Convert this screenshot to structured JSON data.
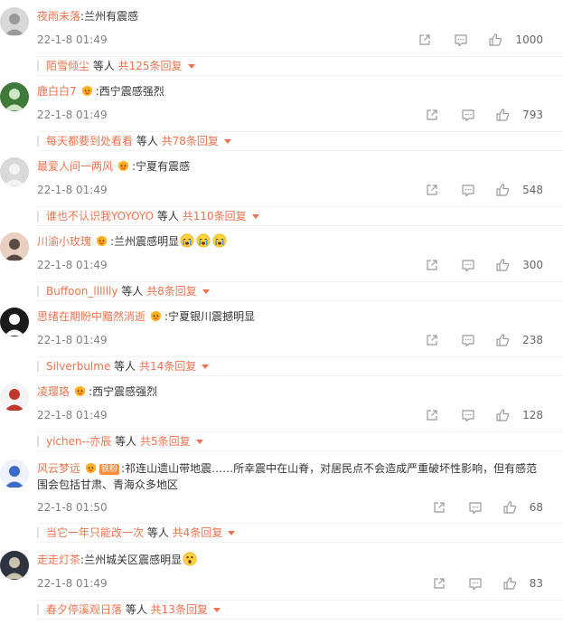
{
  "colors": {
    "accent": "#eb7350",
    "meta": "#808080",
    "text": "#333333"
  },
  "comments": [
    {
      "user": "夜雨未落",
      "badge": false,
      "colon": ":",
      "text": "兰州有震感",
      "emojis": [],
      "time": "22-1-8 01:49",
      "likes": "1000",
      "reply_user": "陌雪倾尘",
      "reply_etc": " 等人 ",
      "reply_total": "共125条回复"
    },
    {
      "user": "鹿白白7",
      "badge": true,
      "colon": ":",
      "text": "西宁震感强烈",
      "emojis": [],
      "time": "22-1-8 01:49",
      "likes": "793",
      "reply_user": "每天都要到处看看",
      "reply_etc": " 等人 ",
      "reply_total": "共78条回复"
    },
    {
      "user": "最爱人间一两风",
      "badge": true,
      "colon": ":",
      "text": "宁夏有震感",
      "emojis": [],
      "time": "22-1-8 01:49",
      "likes": "548",
      "reply_user": "谁也不认识我YOYOYO",
      "reply_etc": " 等人 ",
      "reply_total": "共110条回复"
    },
    {
      "user": "川渝小玫瑰",
      "badge": true,
      "colon": ":",
      "text": "兰州震感明显",
      "emojis": [
        "cry-emoji",
        "cry-emoji",
        "cry-emoji"
      ],
      "time": "22-1-8 01:49",
      "likes": "300",
      "reply_user": "Buffoon_lllllly",
      "reply_etc": " 等人 ",
      "reply_total": "共8条回复"
    },
    {
      "user": "思绪在期盼中黯然消逝",
      "badge": true,
      "colon": ":",
      "text": "宁夏银川震撼明显",
      "emojis": [],
      "time": "22-1-8 01:49",
      "likes": "238",
      "reply_user": "Silverbulme",
      "reply_etc": " 等人 ",
      "reply_total": "共14条回复"
    },
    {
      "user": "凌璎珞",
      "badge": true,
      "colon": ":",
      "text": "西宁震感强烈",
      "emojis": [],
      "time": "22-1-8 01:49",
      "likes": "128",
      "reply_user": "yichen--亦辰",
      "reply_etc": " 等人 ",
      "reply_total": "共5条回复"
    },
    {
      "user": "风云梦远",
      "badge": true,
      "badge_text": "铁粉",
      "colon": ":",
      "text": "祁连山遗山带地震……所幸震中在山脊，对居民点不会造成严重破坏性影响，但有感范围会包括甘肃、青海众多地区",
      "emojis": [],
      "time": "22-1-8 01:50",
      "likes": "68",
      "reply_user": "当它一年只能改一次",
      "reply_etc": " 等人 ",
      "reply_total": "共4条回复"
    },
    {
      "user": "走走灯茶",
      "badge": false,
      "colon": ":",
      "text": "兰州城关区震感明显",
      "emojis": [
        "shock-emoji"
      ],
      "time": "22-1-8 01:49",
      "likes": "83",
      "reply_user": "春夕停溪观日落",
      "reply_etc": " 等人 ",
      "reply_total": "共13条回复"
    }
  ]
}
